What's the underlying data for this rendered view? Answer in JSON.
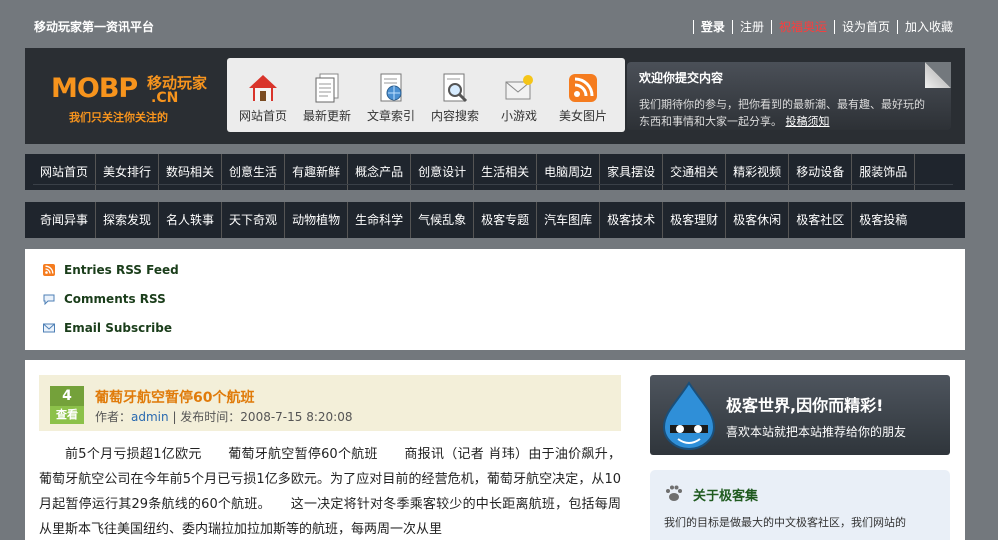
{
  "top": {
    "tagline": "移动玩家第一资讯平台",
    "links": [
      {
        "label": "登录",
        "style": "bold"
      },
      {
        "label": "注册",
        "style": "normal"
      },
      {
        "label": "祝福奥运",
        "style": "red"
      },
      {
        "label": "设为首页",
        "style": "normal"
      },
      {
        "label": "加入收藏",
        "style": "normal"
      }
    ]
  },
  "logo": {
    "main": "MOBP",
    "cn_label": "移动玩家",
    "domain": ".CN",
    "slogan": "我们只关注你关注的"
  },
  "icon_nav": [
    {
      "label": "网站首页",
      "icon": "home-icon"
    },
    {
      "label": "最新更新",
      "icon": "document-icon"
    },
    {
      "label": "文章索引",
      "icon": "globe-document-icon"
    },
    {
      "label": "内容搜索",
      "icon": "search-icon"
    },
    {
      "label": "小游戏",
      "icon": "mail-icon"
    },
    {
      "label": "美女图片",
      "icon": "rss-icon"
    }
  ],
  "welcome": {
    "title": "欢迎你提交内容",
    "text": "我们期待你的参与，把你看到的最新潮、最有趣、最好玩的东西和事情和大家一起分享。",
    "link": "投稿须知"
  },
  "menu_row_1": [
    "网站首页",
    "美女排行",
    "数码相关",
    "创意生活",
    "有趣新鲜",
    "概念产品",
    "创意设计",
    "生活相关",
    "电脑周边",
    "家具摆设",
    "交通相关",
    "精彩视频",
    "移动设备",
    "服装饰品"
  ],
  "menu_row_2": [
    "奇闻异事",
    "探索发现",
    "名人轶事",
    "天下奇观",
    "动物植物",
    "生命科学",
    "气候乱象",
    "极客专题",
    "汽车图库",
    "极客技术",
    "极客理财",
    "极客休闲",
    "极客社区",
    "极客投稿"
  ],
  "rss": [
    {
      "label": "Entries RSS Feed",
      "icon": "rss-feed-icon"
    },
    {
      "label": "Comments RSS",
      "icon": "comment-icon"
    },
    {
      "label": "Email Subscribe",
      "icon": "email-icon"
    }
  ],
  "post": {
    "day": "4",
    "view_label": "查看",
    "title": "葡萄牙航空暂停60个航班",
    "author_prefix": "作者：",
    "author": "admin",
    "time_prefix": " | 发布时间：2008-7-15 8:20:08",
    "body": "前5个月亏损超1亿欧元　　葡萄牙航空暂停60个航班　　商报讯（记者 肖玮）由于油价飙升，葡萄牙航空公司在今年前5个月已亏损1亿多欧元。为了应对目前的经营危机，葡萄牙航空决定，从10月起暂停运行其29条航线的60个航班。　　这一决定将针对冬季乘客较少的中长距离航班，包括每周从里斯本飞往美国纽约、委内瑞拉加拉加斯等的航班，每两周一次从里"
  },
  "promo": {
    "title": "极客世界,因你而精彩!",
    "sub": "喜欢本站就把本站推荐给你的朋友"
  },
  "about": {
    "title": "关于极客集",
    "text": "我们的目标是做最大的中文极客社区，我们网站的"
  },
  "colors": {
    "background": "#73787d",
    "header_dark": "#2a2e33",
    "menu_bar": "#1f252d",
    "logo_orange": "#f7941d",
    "post_title": "#e07b0a",
    "date_green": "#74a13a"
  }
}
